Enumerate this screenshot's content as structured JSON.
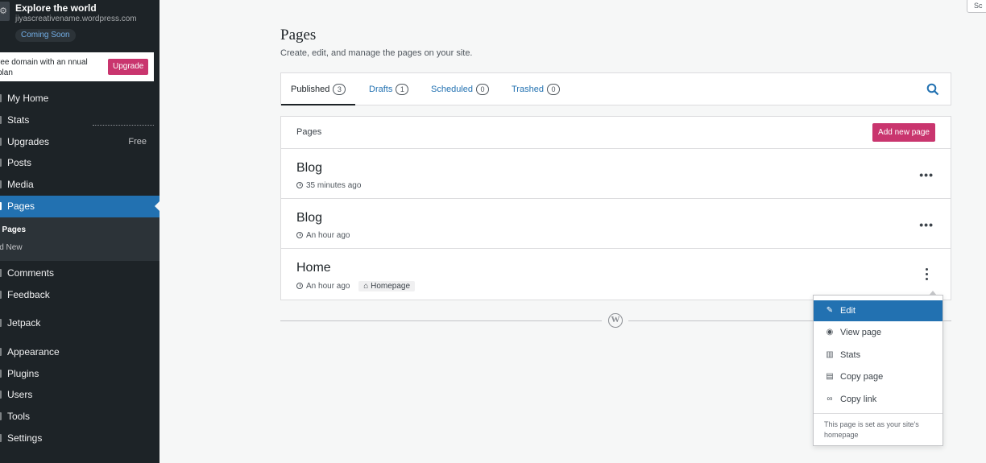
{
  "sidebar": {
    "site_icon": "⚙",
    "site_title": "Explore the world",
    "site_url": "jiyascreativename.wordpress.com",
    "status_badge": "Coming Soon",
    "upsell_text": "ree domain with an nnual plan",
    "upgrade_label": "Upgrade",
    "items": [
      {
        "label": "My Home"
      },
      {
        "label": "Stats"
      },
      {
        "label": "Upgrades",
        "extra": "Free"
      },
      {
        "label": "Posts"
      },
      {
        "label": "Media"
      },
      {
        "label": "Pages"
      },
      {
        "label": "Comments"
      },
      {
        "label": "Feedback"
      },
      {
        "label": "Jetpack"
      },
      {
        "label": "Appearance"
      },
      {
        "label": "Plugins"
      },
      {
        "label": "Users"
      },
      {
        "label": "Tools"
      },
      {
        "label": "Settings"
      }
    ],
    "submenu": [
      "l Pages",
      "ld New"
    ]
  },
  "main": {
    "title": "Pages",
    "subtitle": "Create, edit, and manage the pages on your site.",
    "tabs": [
      {
        "label": "Published",
        "count": "3"
      },
      {
        "label": "Drafts",
        "count": "1"
      },
      {
        "label": "Scheduled",
        "count": "0"
      },
      {
        "label": "Trashed",
        "count": "0"
      }
    ],
    "list_header": "Pages",
    "add_new_label": "Add new page",
    "rows": [
      {
        "title": "Blog",
        "time": "35 minutes ago"
      },
      {
        "title": "Blog",
        "time": "An hour ago"
      },
      {
        "title": "Home",
        "time": "An hour ago",
        "badge": "Homepage"
      }
    ],
    "footer_logo": "W"
  },
  "menu": {
    "items": [
      {
        "label": "Edit",
        "icon": "pencil-icon"
      },
      {
        "label": "View page",
        "icon": "eye-icon"
      },
      {
        "label": "Stats",
        "icon": "stats-icon"
      },
      {
        "label": "Copy page",
        "icon": "clipboard-icon"
      },
      {
        "label": "Copy link",
        "icon": "link-icon"
      }
    ],
    "note": "This page is set as your site's homepage"
  },
  "corner_button": "Sc",
  "colors": {
    "sidebar_bg": "#1d2327",
    "accent_blue": "#2271b1",
    "brand_pink": "#c9356e",
    "page_bg": "#f6f7f7"
  }
}
